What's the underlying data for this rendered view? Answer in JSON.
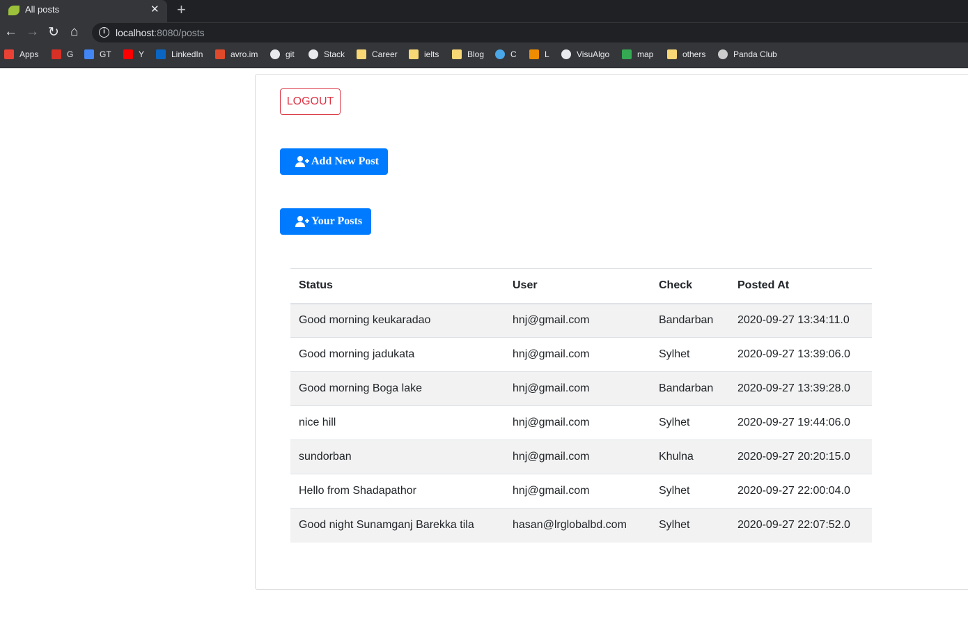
{
  "browser": {
    "tab_title": "All posts",
    "url_host": "localhost",
    "url_path": ":8080/posts",
    "bookmarks": [
      {
        "label": "Apps",
        "icon": "apps-grid-icon",
        "color": "#e94235"
      },
      {
        "label": "G",
        "icon": "gmail-icon",
        "color": "#d93025"
      },
      {
        "label": "GT",
        "icon": "google-translate-icon",
        "color": "#4285f4"
      },
      {
        "label": "Y",
        "icon": "youtube-icon",
        "color": "#ff0000"
      },
      {
        "label": "LinkedIn",
        "icon": "linkedin-icon",
        "color": "#0a66c2"
      },
      {
        "label": "avro.im",
        "icon": "avro-icon",
        "color": "#e04a2a"
      },
      {
        "label": "git",
        "icon": "github-icon",
        "color": "#e8eaed"
      },
      {
        "label": "Stack",
        "icon": "globe-icon",
        "color": "#e8eaed"
      },
      {
        "label": "Career",
        "icon": "folder-icon",
        "color": "#f8d775"
      },
      {
        "label": "ielts",
        "icon": "folder-icon",
        "color": "#f8d775"
      },
      {
        "label": "Blog",
        "icon": "folder-icon",
        "color": "#f8d775"
      },
      {
        "label": "C",
        "icon": "circle-icon",
        "color": "#4aa8e8"
      },
      {
        "label": "L",
        "icon": "leetcode-icon",
        "color": "#f08c00"
      },
      {
        "label": "VisuAlgo",
        "icon": "globe-icon",
        "color": "#e8eaed"
      },
      {
        "label": "map",
        "icon": "maps-pin-icon",
        "color": "#34a853"
      },
      {
        "label": "others",
        "icon": "folder-icon",
        "color": "#f8d775"
      },
      {
        "label": "Panda Club",
        "icon": "panda-icon",
        "color": "#cccccc"
      }
    ]
  },
  "page": {
    "logout": "LOGOUT",
    "add_new_post": "Add New Post",
    "your_posts": "Your Posts"
  },
  "table": {
    "headers": [
      "Status",
      "User",
      "Check",
      "Posted At"
    ],
    "rows": [
      [
        "Good morning keukaradao",
        "hnj@gmail.com",
        "Bandarban",
        "2020-09-27 13:34:11.0"
      ],
      [
        "Good morning jadukata",
        "hnj@gmail.com",
        "Sylhet",
        "2020-09-27 13:39:06.0"
      ],
      [
        "Good morning Boga lake",
        "hnj@gmail.com",
        "Bandarban",
        "2020-09-27 13:39:28.0"
      ],
      [
        "nice hill",
        "hnj@gmail.com",
        "Sylhet",
        "2020-09-27 19:44:06.0"
      ],
      [
        "sundorban",
        "hnj@gmail.com",
        "Khulna",
        "2020-09-27 20:20:15.0"
      ],
      [
        "Hello from Shadapathor",
        "hnj@gmail.com",
        "Sylhet",
        "2020-09-27 22:00:04.0"
      ],
      [
        "Good night Sunamganj Barekka tila",
        "hasan@lrglobalbd.com",
        "Sylhet",
        "2020-09-27 22:07:52.0"
      ]
    ]
  }
}
